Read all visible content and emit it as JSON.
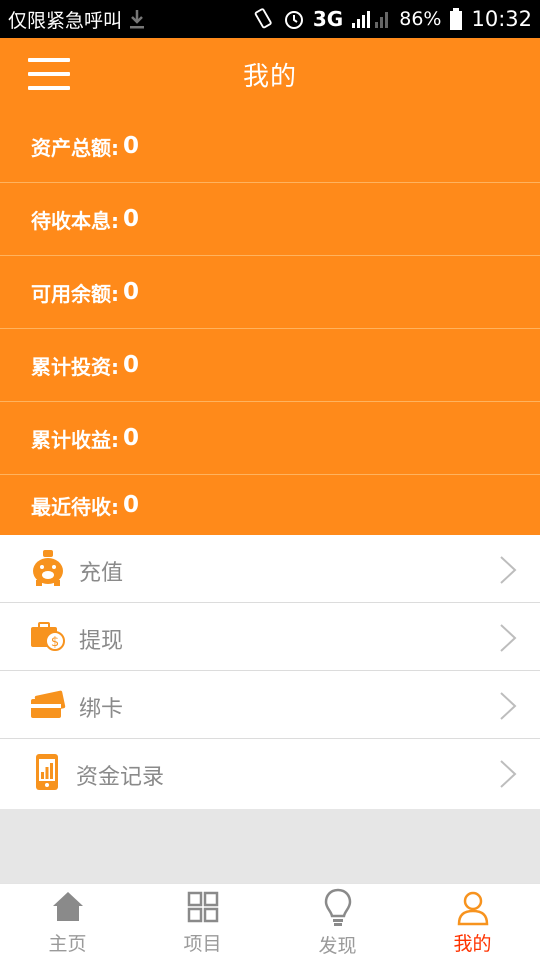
{
  "status_bar": {
    "carrier_text": "仅限紧急呼叫",
    "network": "3G",
    "battery": "86%",
    "time": "10:32",
    "icons": [
      "download-icon",
      "vibrate-icon",
      "alarm-icon",
      "signal-icon",
      "battery-icon"
    ]
  },
  "header": {
    "title": "我的",
    "menu_icon": "hamburger-icon"
  },
  "stats": [
    {
      "label": "资产总额:",
      "value": "0"
    },
    {
      "label": "待收本息:",
      "value": "0"
    },
    {
      "label": "可用余额:",
      "value": "0"
    },
    {
      "label": "累计投资:",
      "value": "0"
    },
    {
      "label": "累计收益:",
      "value": "0"
    },
    {
      "label": "最近待收:",
      "value": "0"
    }
  ],
  "menu": [
    {
      "label": "充值",
      "icon": "piggy-bank-icon"
    },
    {
      "label": "提现",
      "icon": "wallet-icon"
    },
    {
      "label": "绑卡",
      "icon": "card-icon"
    },
    {
      "label": "资金记录",
      "icon": "phone-chart-icon"
    }
  ],
  "tabs": [
    {
      "label": "主页",
      "icon": "home-icon",
      "active": false
    },
    {
      "label": "项目",
      "icon": "grid-icon",
      "active": false
    },
    {
      "label": "发现",
      "icon": "lightbulb-icon",
      "active": false
    },
    {
      "label": "我的",
      "icon": "user-icon",
      "active": true
    }
  ],
  "colors": {
    "accent": "#ff8a1a",
    "icon_orange": "#f7931e",
    "active_tab": "#ff3300",
    "inactive_tab": "#9a9a9a"
  }
}
